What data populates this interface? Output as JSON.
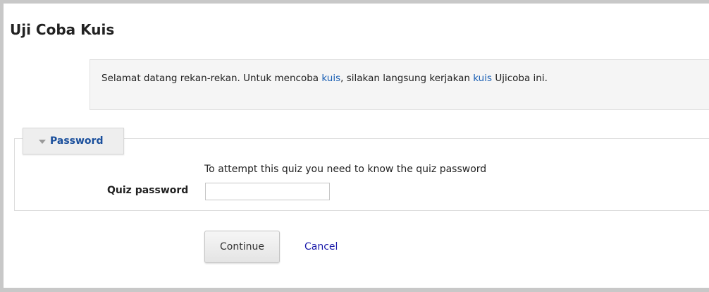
{
  "page": {
    "title": "Uji Coba Kuis"
  },
  "intro": {
    "text_before": "Selamat datang rekan-rekan. Untuk mencoba ",
    "link1": "kuis",
    "text_middle": ", silakan langsung kerjakan ",
    "link2": "kuis",
    "text_after": " Ujicoba ini."
  },
  "password_section": {
    "legend": "Password",
    "notice": "To attempt this quiz you need to know the quiz password",
    "field_label": "Quiz password",
    "field_value": ""
  },
  "actions": {
    "continue_label": "Continue",
    "cancel_label": "Cancel"
  },
  "colors": {
    "link": "#1a5fb4",
    "legend_text": "#1a4f9c",
    "intro_background": "#f5f5f5"
  }
}
